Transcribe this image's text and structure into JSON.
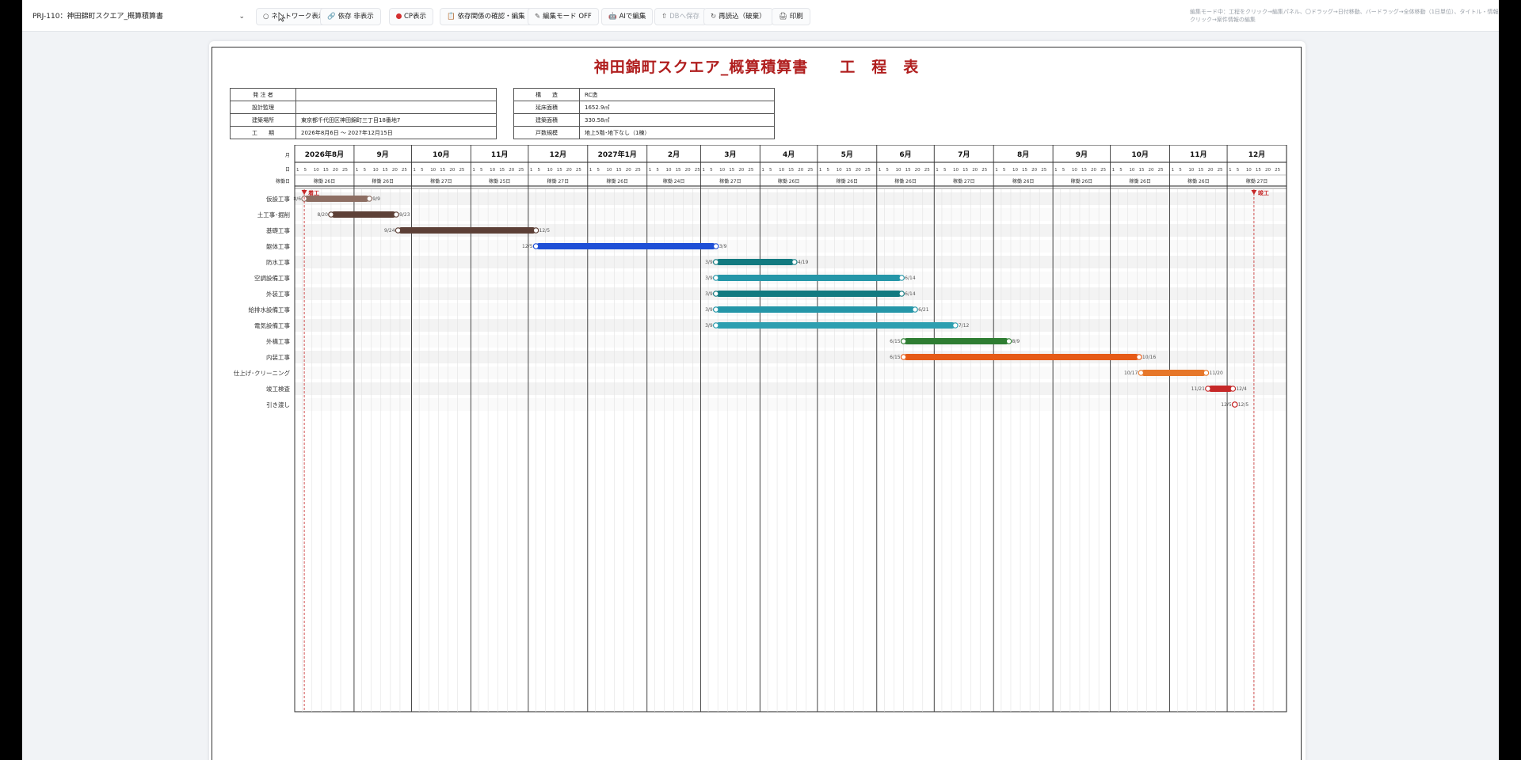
{
  "toolbar": {
    "project": "PRJ-110：神田錦町スクエア_概算積算書",
    "buttons": [
      {
        "icon": "network-icon",
        "glyph": "○",
        "label": "ネットワーク表示へ"
      },
      {
        "icon": "link-icon",
        "glyph": "🔗",
        "label": "依存 非表示"
      },
      {
        "icon": "cp-dot-icon",
        "glyph": "",
        "label": "CP表示"
      },
      {
        "icon": "clipboard-icon",
        "glyph": "📋",
        "label": "依存関係の確認・編集"
      },
      {
        "icon": "pencil-icon",
        "glyph": "✎",
        "label": "編集モード OFF"
      },
      {
        "icon": "robot-icon",
        "glyph": "🤖",
        "label": "AIで編集"
      },
      {
        "icon": "upload-icon",
        "glyph": "⇧",
        "label": "DBへ保存"
      },
      {
        "icon": "reload-icon",
        "glyph": "↻",
        "label": "再読込（破棄）"
      },
      {
        "icon": "print-icon",
        "glyph": "🖨",
        "label": "印刷"
      }
    ],
    "mode_hint": "編集モード中：工程をクリック→編集パネル、〇ドラッグ→日付移動、バードラッグ→全体移動（1日単位）、タイトル・情報表クリック→案件情報の編集"
  },
  "document": {
    "title": "神田錦町スクエア_概算積算書",
    "title_suffix": "工　程　表",
    "info_left": [
      {
        "k": "発 注 者",
        "v": ""
      },
      {
        "k": "設計監理",
        "v": ""
      },
      {
        "k": "建築場所",
        "v": "東京都千代田区神田錦町三丁目18番地7"
      },
      {
        "k": "工　　期",
        "v": "2026年8月6日 〜 2027年12月15日"
      }
    ],
    "info_right": [
      {
        "k": "構　　造",
        "v": "RC造"
      },
      {
        "k": "延床面積",
        "v": "1652.9㎡"
      },
      {
        "k": "建築面積",
        "v": "330.58㎡"
      },
      {
        "k": "戸数規模",
        "v": "地上5階･地下なし（1棟）"
      }
    ]
  },
  "gantt": {
    "row_labels": {
      "month": "月",
      "day": "日",
      "workdays": "稼働日"
    },
    "months": [
      {
        "label": "2026年8月",
        "workdays": "稼働 26日"
      },
      {
        "label": "9月",
        "workdays": "稼働 26日"
      },
      {
        "label": "10月",
        "workdays": "稼働 27日"
      },
      {
        "label": "11月",
        "workdays": "稼働 25日"
      },
      {
        "label": "12月",
        "workdays": "稼働 27日"
      },
      {
        "label": "2027年1月",
        "workdays": "稼働 26日"
      },
      {
        "label": "2月",
        "workdays": "稼働 24日"
      },
      {
        "label": "3月",
        "workdays": "稼働 27日"
      },
      {
        "label": "4月",
        "workdays": "稼働 26日"
      },
      {
        "label": "5月",
        "workdays": "稼働 26日"
      },
      {
        "label": "6月",
        "workdays": "稼働 26日"
      },
      {
        "label": "7月",
        "workdays": "稼働 27日"
      },
      {
        "label": "8月",
        "workdays": "稼働 26日"
      },
      {
        "label": "9月",
        "workdays": "稼働 26日"
      },
      {
        "label": "10月",
        "workdays": "稼働 26日"
      },
      {
        "label": "11月",
        "workdays": "稼働 26日"
      },
      {
        "label": "12月",
        "workdays": "稼働 27日"
      }
    ],
    "day_ticks": [
      "1",
      "5",
      "10",
      "15",
      "20",
      "25"
    ],
    "milestones": [
      {
        "label": "着工",
        "date": "2026-08-06"
      },
      {
        "label": "竣工",
        "date": "2027-12-15"
      }
    ],
    "tasks": [
      {
        "name": "仮設工事",
        "start": "2026-08-06",
        "end": "2026-09-09",
        "start_label": "8/6",
        "end_label": "9/9",
        "color": "#8d6e63"
      },
      {
        "name": "土工事･掘削",
        "start": "2026-08-20",
        "end": "2026-09-23",
        "start_label": "8/20",
        "end_label": "9/23",
        "color": "#5d4037"
      },
      {
        "name": "基礎工事",
        "start": "2026-09-24",
        "end": "2026-12-05",
        "start_label": "9/24",
        "end_label": "12/5",
        "color": "#5d4037"
      },
      {
        "name": "躯体工事",
        "start": "2026-12-05",
        "end": "2027-03-09",
        "start_label": "12/5",
        "end_label": "3/9",
        "color": "#1e4fd6"
      },
      {
        "name": "防水工事",
        "start": "2027-03-09",
        "end": "2027-04-19",
        "start_label": "3/9",
        "end_label": "4/19",
        "color": "#127a80"
      },
      {
        "name": "空調設備工事",
        "start": "2027-03-09",
        "end": "2027-06-14",
        "start_label": "3/9",
        "end_label": "6/14",
        "color": "#2596a8"
      },
      {
        "name": "外装工事",
        "start": "2027-03-09",
        "end": "2027-06-14",
        "start_label": "3/9",
        "end_label": "6/14",
        "color": "#127a80"
      },
      {
        "name": "給排水設備工事",
        "start": "2027-03-09",
        "end": "2027-06-21",
        "start_label": "3/9",
        "end_label": "6/21",
        "color": "#2596a8"
      },
      {
        "name": "電気設備工事",
        "start": "2027-03-09",
        "end": "2027-07-12",
        "start_label": "3/9",
        "end_label": "7/12",
        "color": "#2e9fb0"
      },
      {
        "name": "外構工事",
        "start": "2027-06-15",
        "end": "2027-08-09",
        "start_label": "6/15",
        "end_label": "8/9",
        "color": "#2e7d32"
      },
      {
        "name": "内装工事",
        "start": "2027-06-15",
        "end": "2027-10-16",
        "start_label": "6/15",
        "end_label": "10/16",
        "color": "#e65a16"
      },
      {
        "name": "仕上げ･クリーニング",
        "start": "2027-10-17",
        "end": "2027-11-20",
        "start_label": "10/17",
        "end_label": "11/20",
        "color": "#e6772a"
      },
      {
        "name": "竣工検査",
        "start": "2027-11-21",
        "end": "2027-12-04",
        "start_label": "11/21",
        "end_label": "12/4",
        "color": "#c62828"
      },
      {
        "name": "引き渡し",
        "start": "2027-12-05",
        "end": "2027-12-05",
        "start_label": "12/5",
        "end_label": "12/5",
        "color": "#c62828"
      }
    ]
  }
}
